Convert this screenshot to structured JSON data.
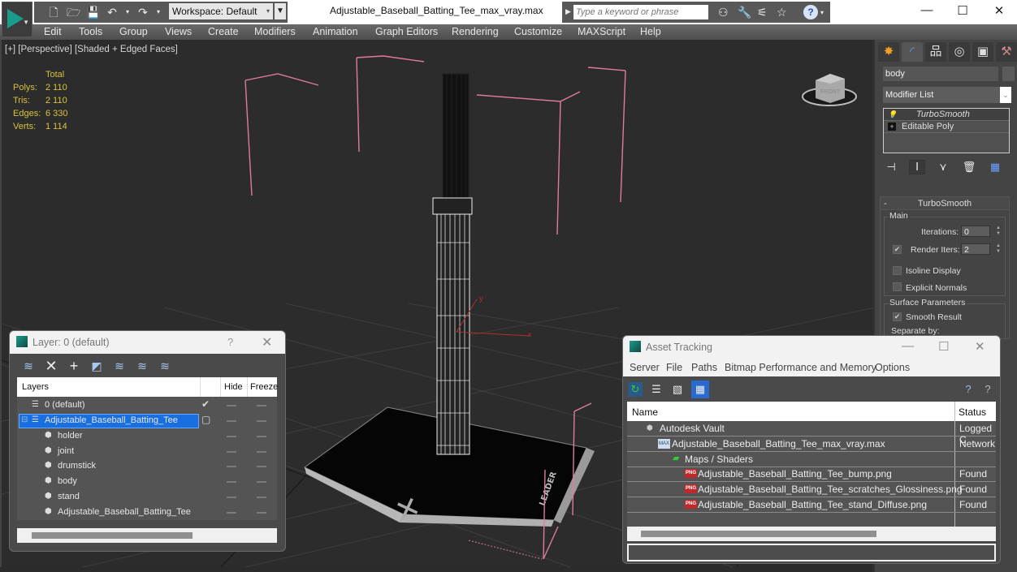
{
  "titlebar": {
    "workspace_label": "Workspace: Default",
    "file_title": "Adjustable_Baseball_Batting_Tee_max_vray.max",
    "search_placeholder": "Type a keyword or phrase",
    "quick_access": [
      "new-icon",
      "open-icon",
      "save-icon",
      "undo-icon",
      "redo-icon",
      "project-folder-icon"
    ],
    "search_tools": [
      "binoculars-icon",
      "wrench-icon",
      "satellite-icon",
      "star-icon"
    ],
    "help_label": "?",
    "window_controls": {
      "minimize": "—",
      "maximize": "☐",
      "close": "✕"
    }
  },
  "menubar": {
    "items": [
      "Edit",
      "Tools",
      "Group",
      "Views",
      "Create",
      "Modifiers",
      "Animation",
      "Graph Editors",
      "Rendering",
      "Customize",
      "MAXScript",
      "Help"
    ]
  },
  "viewport": {
    "label": "[+] [Perspective] [Shaded + Edged Faces]",
    "stats": {
      "header": "Total",
      "rows": [
        {
          "key": "Polys:",
          "value": "2 110"
        },
        {
          "key": "Tris:",
          "value": "2 110"
        },
        {
          "key": "Edges:",
          "value": "6 330"
        },
        {
          "key": "Verts:",
          "value": "1 114"
        }
      ]
    },
    "viewcube_label": "FRONT",
    "base_logo_text": "LEADER",
    "axis_labels": {
      "x": "x",
      "y": "y"
    }
  },
  "command_panel": {
    "tabs": [
      "create-icon",
      "modify-icon",
      "hierarchy-icon",
      "motion-icon",
      "display-icon",
      "utilities-icon"
    ],
    "object_name": "body",
    "modifier_list_label": "Modifier List",
    "stack": [
      {
        "label": "TurboSmooth",
        "selected": true
      },
      {
        "label": "Editable Poly",
        "selected": false
      }
    ],
    "turbosmooth": {
      "title": "TurboSmooth",
      "collapse": "-",
      "main_group": "Main",
      "iterations_label": "Iterations:",
      "iterations_value": "0",
      "render_iters_label": "Render Iters:",
      "render_iters_value": "2",
      "render_iters_checked": true,
      "isoline_label": "Isoline Display",
      "isoline_checked": false,
      "explicit_normals_label": "Explicit Normals",
      "explicit_normals_checked": false,
      "surface_group": "Surface Parameters",
      "smooth_result_label": "Smooth Result",
      "smooth_result_checked": true,
      "separate_by_label": "Separate by:"
    }
  },
  "layer_dialog": {
    "title": "Layer: 0 (default)",
    "help": "?",
    "close": "✕",
    "columns": {
      "layers": "Layers",
      "hide": "Hide",
      "freeze": "Freeze"
    },
    "rows": [
      {
        "name": "0 (default)",
        "type": "layer",
        "indent": 1,
        "current": true,
        "selected": false
      },
      {
        "name": "Adjustable_Baseball_Batting_Tee",
        "type": "layer",
        "indent": 1,
        "current": false,
        "selected": true,
        "expand": "⊟"
      },
      {
        "name": "holder",
        "type": "object",
        "indent": 2
      },
      {
        "name": "joint",
        "type": "object",
        "indent": 2
      },
      {
        "name": "drumstick",
        "type": "object",
        "indent": 2
      },
      {
        "name": "body",
        "type": "object",
        "indent": 2
      },
      {
        "name": "stand",
        "type": "object",
        "indent": 2
      },
      {
        "name": "Adjustable_Baseball_Batting_Tee",
        "type": "object",
        "indent": 2
      }
    ]
  },
  "asset_dialog": {
    "title": "Asset Tracking",
    "menu": [
      "Server",
      "File",
      "Paths",
      "Bitmap Performance and Memory",
      "Options"
    ],
    "columns": {
      "name": "Name",
      "status": "Status"
    },
    "rows": [
      {
        "name": "Autodesk Vault",
        "status": "Logged C",
        "icon": "vault-icon",
        "indent": 1
      },
      {
        "name": "Adjustable_Baseball_Batting_Tee_max_vray.max",
        "status": "Network",
        "icon": "max-file-icon",
        "indent": 2
      },
      {
        "name": "Maps / Shaders",
        "status": "",
        "icon": "maps-icon",
        "indent": 3
      },
      {
        "name": "Adjustable_Baseball_Batting_Tee_bump.png",
        "status": "Found",
        "icon": "png-icon",
        "indent": 4
      },
      {
        "name": "Adjustable_Baseball_Batting_Tee_scratches_Glossiness.png",
        "status": "Found",
        "icon": "png-icon",
        "indent": 4
      },
      {
        "name": "Adjustable_Baseball_Batting_Tee_stand_Diffuse.png",
        "status": "Found",
        "icon": "png-icon",
        "indent": 4
      }
    ],
    "png_badge": "PNG"
  },
  "colors": {
    "selection_blue": "#1a6fe0",
    "stats_yellow": "#d8c23a",
    "bbox_pink": "#e07aa0",
    "app_teal": "#1a9c8c"
  }
}
